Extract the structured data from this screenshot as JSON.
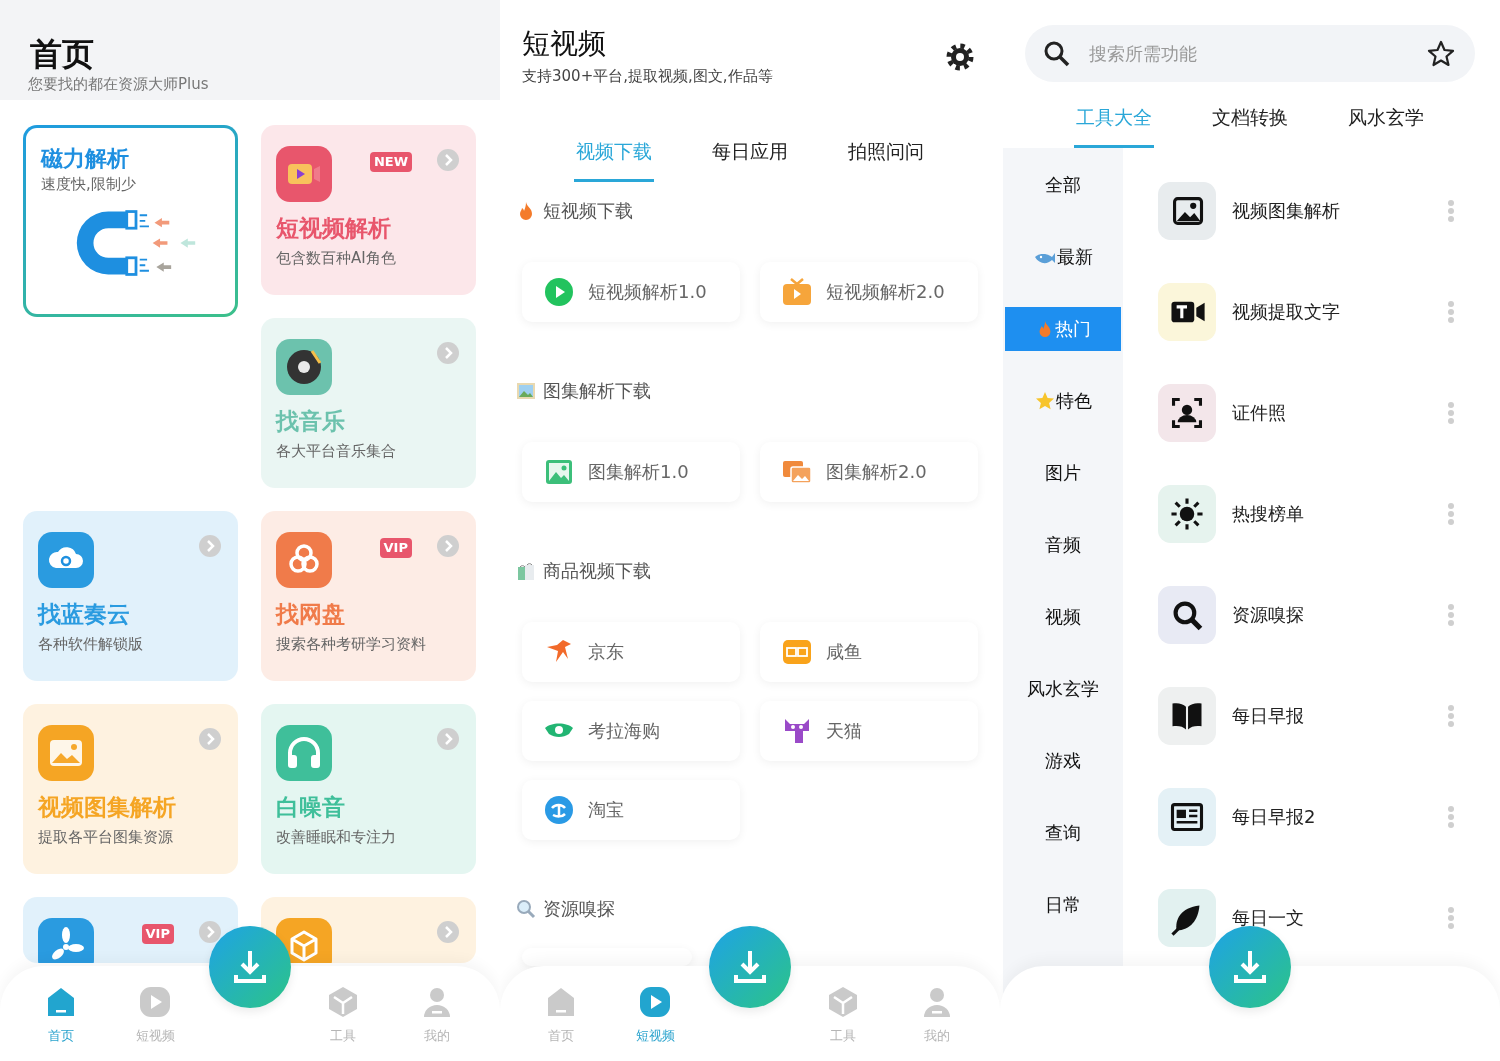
{
  "home": {
    "title": "首页",
    "subtitle": "您要找的都在资源大师Plus",
    "cards": [
      {
        "kind": "featured",
        "title": "磁力解析",
        "subtitle": "速度快,限制少",
        "color": "#1e8fe0"
      },
      {
        "kind": "tile",
        "title": "短视频解析",
        "subtitle": "包含数百种AI角色",
        "badge": "NEW",
        "color": "#e8566c"
      },
      {
        "kind": "tile",
        "title": "找音乐",
        "subtitle": "各大平台音乐集合",
        "color": "#6cc2ad"
      },
      {
        "kind": "tile",
        "title": "找蓝奏云",
        "subtitle": "各种软件解锁版",
        "color": "#2a9be0"
      },
      {
        "kind": "tile",
        "title": "找网盘",
        "subtitle": "搜索各种考研学习资料",
        "badge": "VIP",
        "color": "#f07b4a"
      },
      {
        "kind": "tile",
        "title": "视频图集解析",
        "subtitle": "提取各平台图集资源",
        "color": "#f5a524"
      },
      {
        "kind": "tile",
        "title": "白噪音",
        "subtitle": "改善睡眠和专注力",
        "color": "#3fbf9a"
      },
      {
        "kind": "tile",
        "badge": "VIP",
        "color": "#2a9be0"
      },
      {
        "kind": "tile",
        "color": "#f5a524"
      }
    ],
    "nav": [
      {
        "label": "首页",
        "selected": true
      },
      {
        "label": "短视频",
        "selected": false
      },
      {
        "label": "工具",
        "selected": false
      },
      {
        "label": "我的",
        "selected": false
      }
    ]
  },
  "video": {
    "title": "短视频",
    "subtitle": "支持300+平台,提取视频,图文,作品等",
    "tabs": [
      {
        "label": "视频下载",
        "selected": true
      },
      {
        "label": "每日应用",
        "selected": false
      },
      {
        "label": "拍照问问",
        "selected": false
      }
    ],
    "sections": [
      {
        "title": "短视频下载",
        "items": [
          {
            "kind": "full",
            "label": "短视频解析1.0"
          },
          {
            "kind": "full",
            "label": "短视频解析2.0"
          }
        ]
      },
      {
        "title": "图集解析下载",
        "items": [
          {
            "kind": "full",
            "label": "图集解析1.0"
          },
          {
            "kind": "full",
            "label": "图集解析2.0"
          }
        ]
      },
      {
        "title": "商品视频下载",
        "items": [
          {
            "kind": "full",
            "label": "京东"
          },
          {
            "kind": "full",
            "label": "咸鱼"
          },
          {
            "kind": "full",
            "label": "考拉海购"
          },
          {
            "kind": "full",
            "label": "天猫"
          },
          {
            "kind": "full",
            "label": "淘宝"
          }
        ]
      },
      {
        "title": "资源嗅探",
        "items": [
          {
            "kind": "cut"
          }
        ]
      }
    ],
    "nav": [
      {
        "label": "首页",
        "selected": false
      },
      {
        "label": "短视频",
        "selected": true
      },
      {
        "label": "工具",
        "selected": false
      },
      {
        "label": "我的",
        "selected": false
      }
    ]
  },
  "tools": {
    "search": {
      "placeholder": "搜索所需功能"
    },
    "tabs": [
      {
        "label": "工具大全",
        "selected": true
      },
      {
        "label": "文档转换",
        "selected": false
      },
      {
        "label": "风水玄学",
        "selected": false
      }
    ],
    "categories": [
      {
        "label": "全部",
        "selected": false
      },
      {
        "label": "最新",
        "selected": false
      },
      {
        "label": "热门",
        "selected": true
      },
      {
        "label": "特色",
        "selected": false
      },
      {
        "label": "图片",
        "selected": false
      },
      {
        "label": "音频",
        "selected": false
      },
      {
        "label": "视频",
        "selected": false
      },
      {
        "label": "风水玄学",
        "selected": false
      },
      {
        "label": "游戏",
        "selected": false
      },
      {
        "label": "查询",
        "selected": false
      },
      {
        "label": "日常",
        "selected": false
      }
    ],
    "items": [
      {
        "label": "视频图集解析"
      },
      {
        "label": "视频提取文字"
      },
      {
        "label": "证件照"
      },
      {
        "label": "热搜榜单"
      },
      {
        "label": "资源嗅探"
      },
      {
        "label": "每日早报"
      },
      {
        "label": "每日早报2"
      },
      {
        "label": "每日一文"
      }
    ]
  }
}
